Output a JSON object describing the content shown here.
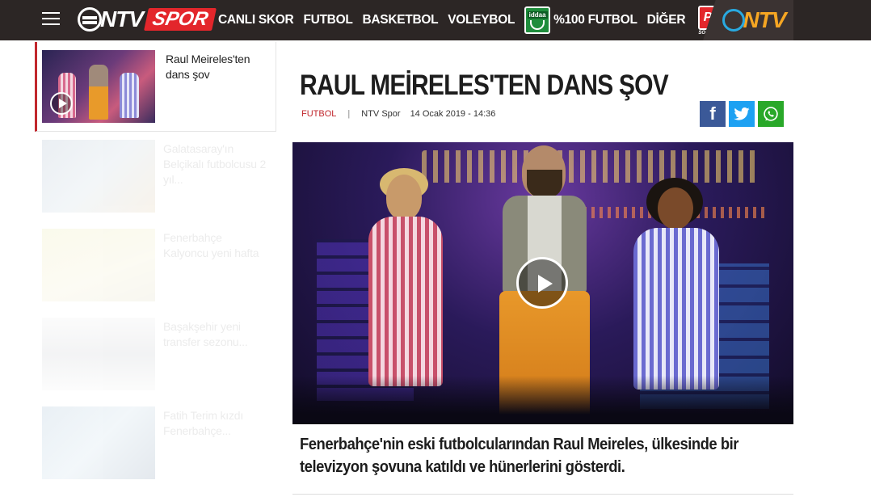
{
  "header": {
    "logo_text": "NTV",
    "logo_sub": "SPOR",
    "nav": [
      "CANLI SKOR",
      "FUTBOL",
      "BASKETBOL",
      "VOLEYBOL"
    ],
    "iddaa_label": "iddaa",
    "iddaa_text": "%100 FUTBOL",
    "other_label": "DİĞER",
    "po_label": "PO",
    "po_sub": "SOSYAL LİG",
    "right_logo": "NTV"
  },
  "sidebar": {
    "items": [
      {
        "title": "Raul Meireles'ten dans şov"
      },
      {
        "title": "Galatasaray'ın Belçikalı futbolcusu 2 yıl..."
      },
      {
        "title": "Fenerbahçe Kalyoncu yeni hafta"
      },
      {
        "title": "Başakşehir yeni transfer sezonu..."
      },
      {
        "title": "Fatih Terim kızdı Fenerbahçe..."
      }
    ]
  },
  "article": {
    "title": "RAUL MEİRELES'TEN DANS ŞOV",
    "category": "FUTBOL",
    "separator": "|",
    "source": "NTV Spor",
    "date": "14 Ocak 2019 - 14:36",
    "summary": "Fenerbahçe'nin eski futbolcularından Raul Meireles, ülkesinde bir televizyon şovuna katıldı ve hünerlerini gösterdi."
  },
  "share": {
    "facebook_icon": "f",
    "twitter_icon": "twitter-bird",
    "whatsapp_icon": "whatsapp-phone"
  },
  "colors": {
    "topbar": "#2c2625",
    "accent_red": "#c1272d",
    "facebook": "#3b5998",
    "twitter": "#1da1f2",
    "whatsapp": "#29a829"
  }
}
